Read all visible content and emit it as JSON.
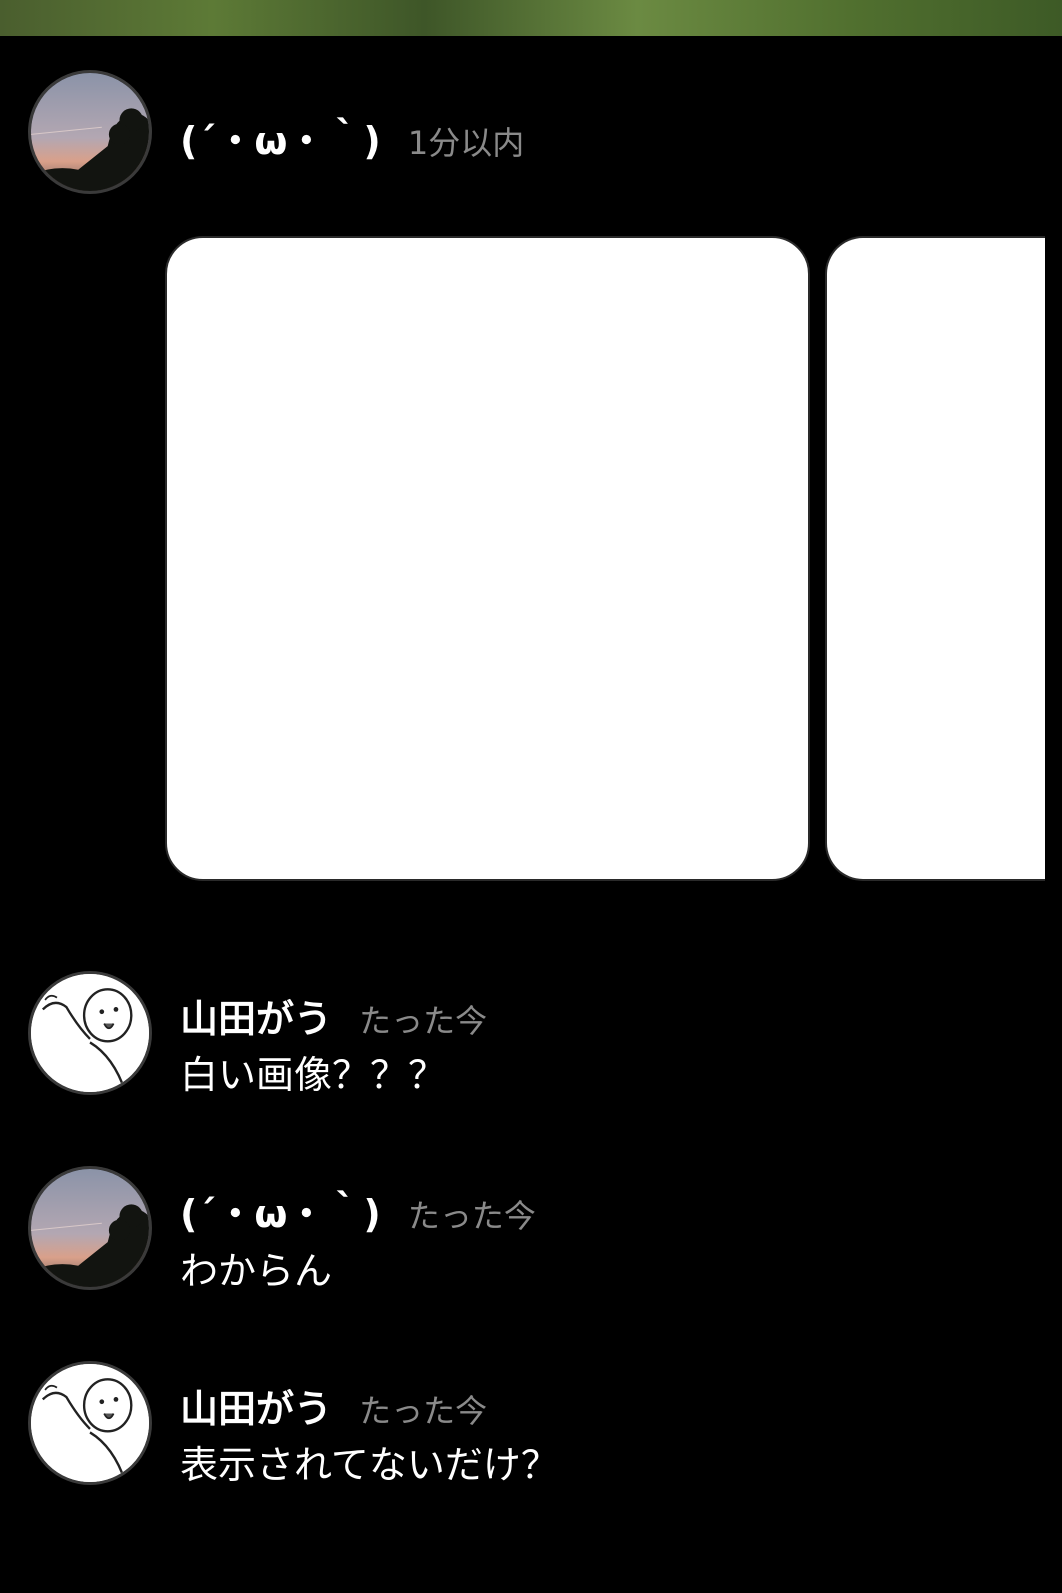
{
  "posts": [
    {
      "username": "(´・ω・｀)",
      "timestamp": "1分以内",
      "avatar_icon": "sunset-tree-avatar-icon",
      "attachments": [
        "white-image",
        "white-image"
      ]
    }
  ],
  "messages": [
    {
      "username": "山田がう",
      "timestamp": "たった今",
      "text": "白い画像？？？",
      "avatar_icon": "cartoon-character-avatar-icon"
    },
    {
      "username": "(´・ω・｀)",
      "timestamp": "たった今",
      "text": "わからん",
      "avatar_icon": "sunset-tree-avatar-icon"
    },
    {
      "username": "山田がう",
      "timestamp": "たった今",
      "text": "表示されてないだけ？",
      "avatar_icon": "cartoon-character-avatar-icon"
    }
  ],
  "colors": {
    "background": "#000000",
    "timestamp": "#8a8a8a",
    "card": "#ffffff"
  }
}
